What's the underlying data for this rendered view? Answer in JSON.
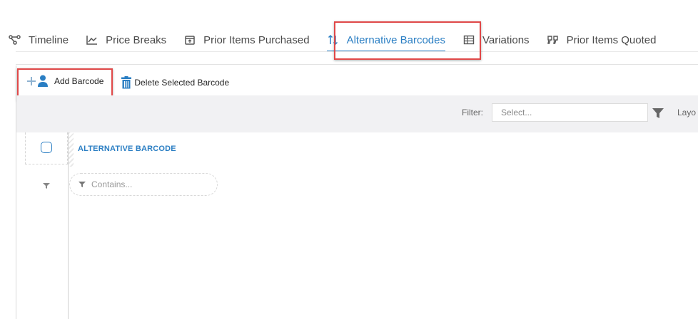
{
  "tabs": [
    {
      "label": "Timeline",
      "icon": "timeline-icon"
    },
    {
      "label": "Price Breaks",
      "icon": "chart-line-icon"
    },
    {
      "label": "Prior Items Purchased",
      "icon": "box-upload-icon"
    },
    {
      "label": "Alternative Barcodes",
      "icon": "sort-arrows-icon",
      "active": true
    },
    {
      "label": "Variations",
      "icon": "table-icon"
    },
    {
      "label": "Prior Items Quoted",
      "icon": "quote-icon"
    }
  ],
  "toolbar": {
    "add_label": "Add Barcode",
    "delete_label": "Delete Selected Barcode"
  },
  "filterbar": {
    "filter_label": "Filter:",
    "filter_placeholder": "Select...",
    "layout_label": "Layo"
  },
  "grid": {
    "column_header": "ALTERNATIVE BARCODE",
    "contains_placeholder": "Contains..."
  },
  "colors": {
    "accent": "#2a7ec3",
    "highlight": "#e04848"
  }
}
